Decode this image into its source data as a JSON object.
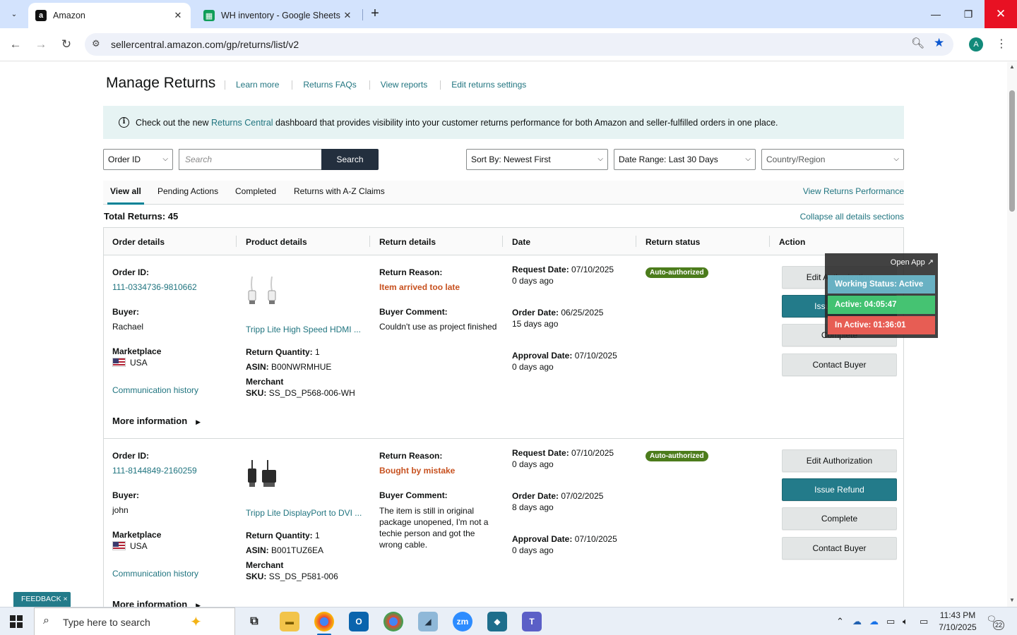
{
  "browser": {
    "tabs": [
      {
        "title": "Amazon",
        "favicon": "amazon-icon"
      },
      {
        "title": "WH inventory - Google Sheets",
        "favicon": "sheets-icon"
      }
    ],
    "url": "sellercentral.amazon.com/gp/returns/list/v2",
    "profile_initial": "A"
  },
  "page": {
    "title": "Manage Returns",
    "top_links": [
      "Learn more",
      "Returns FAQs",
      "View reports",
      "Edit returns settings"
    ],
    "banner": {
      "prefix": "Check out the new ",
      "link": "Returns Central",
      "suffix": " dashboard that provides visibility into your customer returns performance for both Amazon and seller-fulfilled orders in one place."
    },
    "filters": {
      "search_field": "Order ID",
      "search_placeholder": "Search",
      "search_button": "Search",
      "sort": "Sort By: Newest First",
      "date_range": "Date Range: Last 30 Days",
      "country": "Country/Region"
    },
    "tabs": [
      "View all",
      "Pending Actions",
      "Completed",
      "Returns with A-Z Claims"
    ],
    "performance_link": "View Returns Performance",
    "total_returns": "Total Returns: 45",
    "collapse_link": "Collapse all details sections",
    "columns": [
      "Order details",
      "Product details",
      "Return details",
      "Date",
      "Return status",
      "Action"
    ],
    "labels": {
      "order_id": "Order ID:",
      "buyer": "Buyer:",
      "marketplace": "Marketplace",
      "communication": "Communication history",
      "more_info": "More information",
      "return_quantity": "Return Quantity:",
      "asin": "ASIN:",
      "merchant": "Merchant",
      "sku": "SKU:",
      "return_reason": "Return Reason:",
      "buyer_comment": "Buyer Comment:",
      "request_date": "Request Date:",
      "order_date": "Order Date:",
      "approval_date": "Approval Date:"
    },
    "actions": [
      "Edit Authorization",
      "Issue Refund",
      "Complete",
      "Contact Buyer"
    ],
    "rows": [
      {
        "order_id": "111-0334736-9810662",
        "buyer": "Rachael",
        "marketplace": "USA",
        "product": "Tripp Lite High Speed HDMI ...",
        "quantity": "1",
        "asin": "B00NWRMHUE",
        "sku": "SS_DS_P568-006-WH",
        "reason": "Item arrived too late",
        "comment": "Couldn't use as project finished",
        "request_date": "07/10/2025",
        "request_ago": "0 days ago",
        "order_date": "06/25/2025",
        "order_ago": "15 days ago",
        "approval_date": "07/10/2025",
        "approval_ago": "0 days ago",
        "status": "Auto-authorized"
      },
      {
        "order_id": "111-8144849-2160259",
        "buyer": "john",
        "marketplace": "USA",
        "product": "Tripp Lite DisplayPort to DVI ...",
        "quantity": "1",
        "asin": "B001TUZ6EA",
        "sku": "SS_DS_P581-006",
        "reason": "Bought by mistake",
        "comment": "The item is still in original package unopened, I'm not a techie person and got the wrong cable.",
        "request_date": "07/10/2025",
        "request_ago": "0 days ago",
        "order_date": "07/02/2025",
        "order_ago": "8 days ago",
        "approval_date": "07/10/2025",
        "approval_ago": "0 days ago",
        "status": "Auto-authorized"
      }
    ]
  },
  "tracker": {
    "open_app": "Open App ↗",
    "working_status": "Working Status: Active",
    "active": "Active: 04:05:47",
    "inactive": "In Active: 01:36:01"
  },
  "feedback": "FEEDBACK ×",
  "taskbar": {
    "search_placeholder": "Type here to search",
    "time": "11:43 PM",
    "date": "7/10/2025",
    "notifications": "22"
  },
  "colors": {
    "link": "#217580",
    "primary_button": "#237b8a",
    "badge": "#4c7c1c",
    "reason": "#c7511f"
  }
}
